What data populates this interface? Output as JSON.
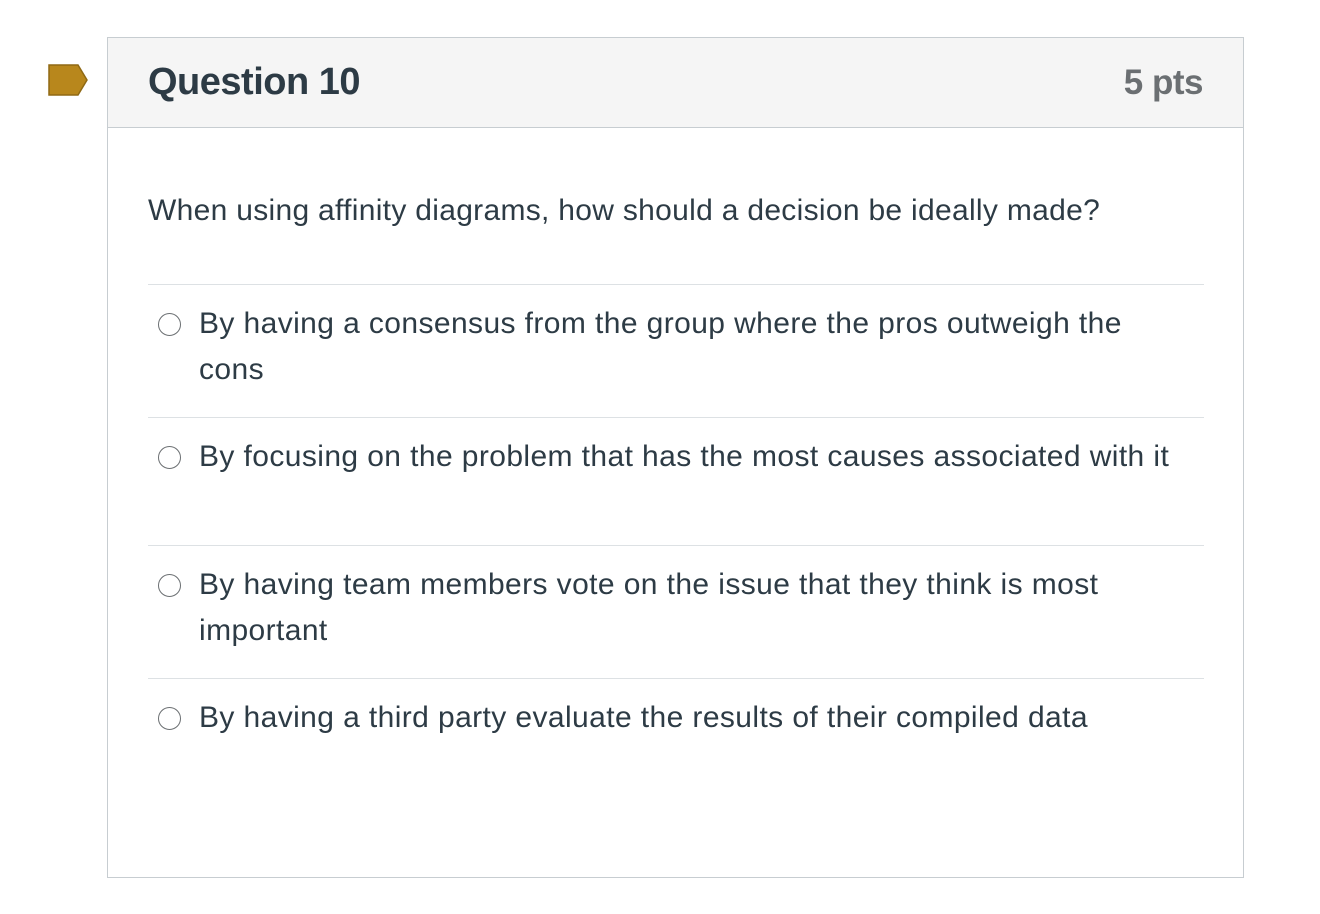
{
  "question": {
    "title": "Question 10",
    "points": "5 pts",
    "text": "When using affinity diagrams, how should a decision be ideally made?",
    "answers": [
      {
        "label": "By having a consensus from the group where the pros outweigh the cons"
      },
      {
        "label": "By focusing on the problem that has the most causes associated with it"
      },
      {
        "label": "By having team members vote on the issue that they think is most important"
      },
      {
        "label": "By having a third party evaluate the results of their compiled data"
      }
    ]
  },
  "colors": {
    "flag": "#b8871c",
    "header_bg": "#f5f5f5",
    "border": "#c7cdd1",
    "text": "#2d3b45",
    "points": "#6b6f72"
  },
  "icons": {
    "flag": "bookmark-flag-icon"
  }
}
